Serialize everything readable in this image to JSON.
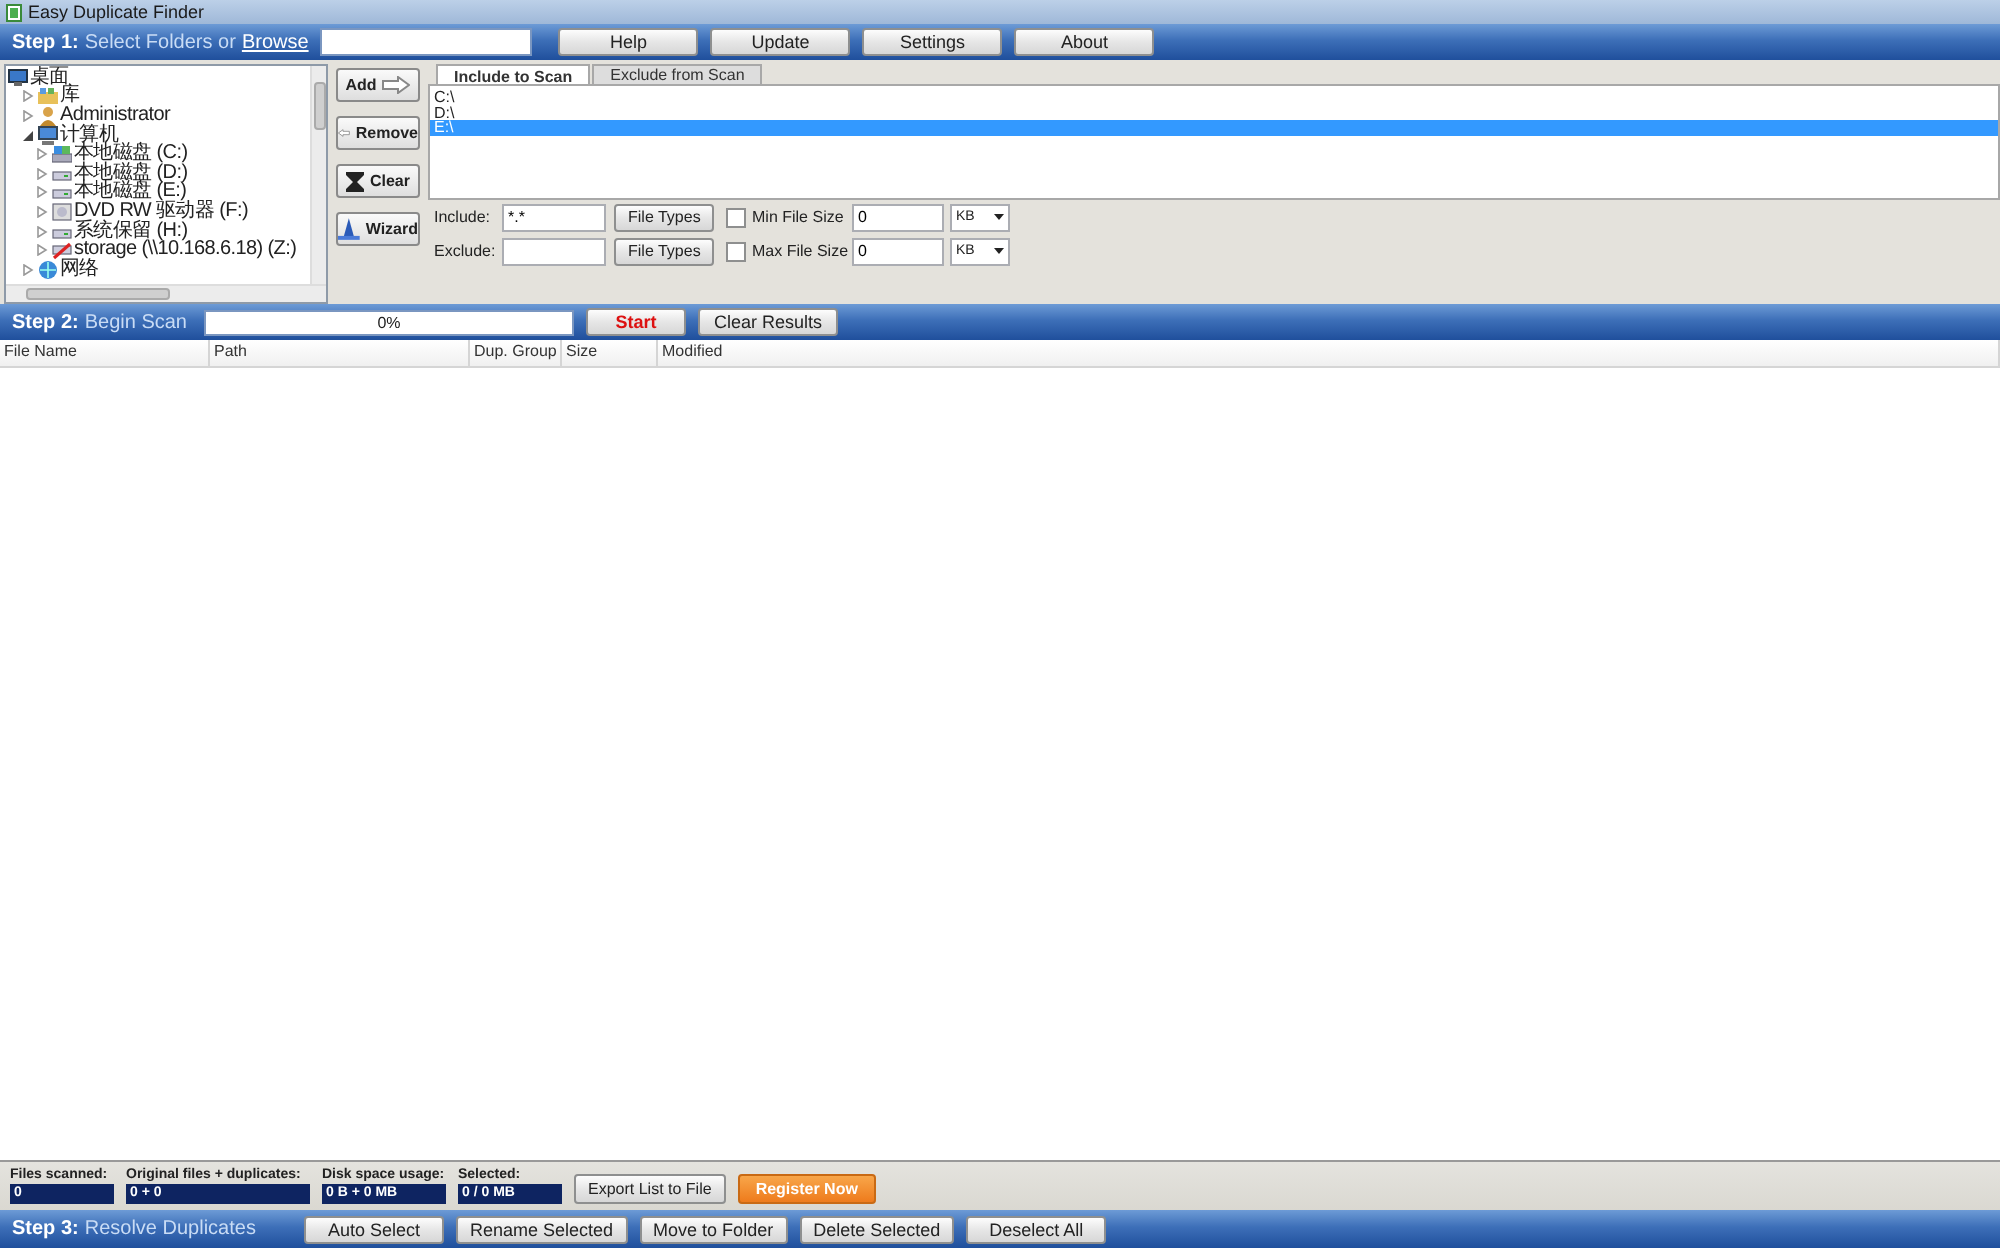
{
  "window": {
    "title": "Easy Duplicate Finder"
  },
  "step1": {
    "step": "Step 1:",
    "label": "Select Folders or",
    "link": "Browse",
    "buttons": [
      "Help",
      "Update",
      "Settings",
      "About"
    ]
  },
  "folder_tree": [
    {
      "label": "桌面",
      "kind": "desktop",
      "children": [
        {
          "label": "库",
          "kind": "library",
          "expanded": false
        },
        {
          "label": "Administrator",
          "kind": "user",
          "expanded": false
        },
        {
          "label": "计算机",
          "kind": "computer",
          "expanded": true,
          "children": [
            {
              "label": "本地磁盘 (C:)",
              "kind": "system-disk",
              "expanded": false
            },
            {
              "label": "本地磁盘 (D:)",
              "kind": "disk",
              "expanded": false
            },
            {
              "label": "本地磁盘 (E:)",
              "kind": "disk",
              "expanded": false
            },
            {
              "label": "DVD RW 驱动器 (F:)",
              "kind": "dvd",
              "expanded": false
            },
            {
              "label": "系统保留 (H:)",
              "kind": "disk",
              "expanded": false
            },
            {
              "label": "storage (\\\\10.168.6.18) (Z:)",
              "kind": "netdrive",
              "expanded": false
            }
          ]
        },
        {
          "label": "网络",
          "kind": "network",
          "expanded": false
        }
      ]
    }
  ],
  "side_buttons": [
    {
      "label": "Add",
      "kind": "add"
    },
    {
      "label": "Remove",
      "kind": "remove"
    },
    {
      "label": "Clear",
      "kind": "clear"
    },
    {
      "label": "Wizard",
      "kind": "wizard"
    }
  ],
  "tabs": [
    {
      "label": "Include to Scan",
      "selected": true
    },
    {
      "label": "Exclude from Scan",
      "selected": false
    }
  ],
  "scan_list": [
    {
      "path": "C:\\",
      "selected": false
    },
    {
      "path": "D:\\",
      "selected": false
    },
    {
      "path": "E:\\",
      "selected": true
    }
  ],
  "filters": [
    {
      "label": "Include:",
      "value": "*.*",
      "button": "File Types",
      "size_label": "Min File Size",
      "size_checked": false,
      "size_value": "0",
      "unit": "KB"
    },
    {
      "label": "Exclude:",
      "button": "File Types",
      "size_label": "Max File Size",
      "size_checked": false,
      "size_value": "0",
      "unit": "KB"
    }
  ],
  "step2": {
    "step": "Step 2:",
    "label": "Begin Scan",
    "progress": {
      "level": 0,
      "reading": "0%"
    },
    "buttons": [
      {
        "label": "Start",
        "kind": "start"
      },
      {
        "label": "Clear Results",
        "kind": "normal"
      }
    ]
  },
  "table": {
    "columns": [
      "File Name",
      "Path",
      "Dup. Group",
      "Size",
      "Modified"
    ]
  },
  "stats": [
    {
      "label": "Files scanned:",
      "value": "0"
    },
    {
      "label": "Original files + duplicates:",
      "value": "0 + 0"
    },
    {
      "label": "Disk space usage:",
      "value": "0 B + 0 MB"
    },
    {
      "label": "Selected:",
      "value": "0 / 0 MB"
    }
  ],
  "stat_buttons": [
    {
      "label": "Export List to File",
      "kind": "normal"
    },
    {
      "label": "Register Now",
      "kind": "register"
    }
  ],
  "step3": {
    "step": "Step 3:",
    "label": "Resolve Duplicates",
    "buttons": [
      "Auto Select",
      "Rename Selected",
      "Move to Folder",
      "Delete Selected",
      "Deselect All"
    ]
  }
}
